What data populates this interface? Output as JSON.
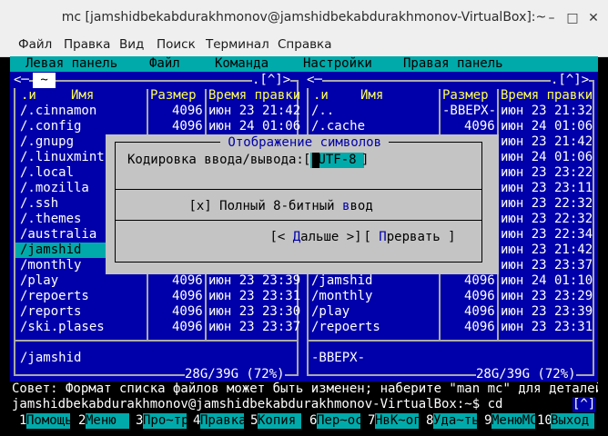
{
  "window": {
    "title": "mc [jamshidbekabdurakhmonov@jamshidbekabdurakhmonov-VirtualBox]:~",
    "minimize_glyph": "–",
    "maximize_glyph": "□",
    "close_glyph": "✕"
  },
  "menubar": {
    "items": [
      "Файл",
      "Правка",
      "Вид",
      "Поиск",
      "Терминал",
      "Справка"
    ]
  },
  "mc_menu": {
    "items": [
      "Левая панель",
      "Файл",
      "Команда",
      "Настройки",
      "Правая панель"
    ]
  },
  "left_panel": {
    "top_left": "<─",
    "tab": " ~ ",
    "top_right": ".[^]>",
    "col_n": ".и",
    "col_name": "Имя",
    "col_size": "Размер",
    "col_time": "Время правки",
    "rows": [
      {
        "name": "/.cinnamon",
        "size": "4096",
        "time": "июн 23 21:42"
      },
      {
        "name": "/.config",
        "size": "4096",
        "time": "июн 24 01:06"
      },
      {
        "name": "/.gnupg",
        "size": "",
        "time": ""
      },
      {
        "name": "/.linuxmint",
        "size": "",
        "time": ""
      },
      {
        "name": "/.local",
        "size": "",
        "time": ""
      },
      {
        "name": "/.mozilla",
        "size": "",
        "time": ""
      },
      {
        "name": "/.ssh",
        "size": "",
        "time": ""
      },
      {
        "name": "/.themes",
        "size": "",
        "time": ""
      },
      {
        "name": "/australia",
        "size": "",
        "time": ""
      },
      {
        "name": "/jamshid",
        "size": "",
        "time": ""
      },
      {
        "name": "/monthly",
        "size": "",
        "time": ""
      },
      {
        "name": "/play",
        "size": "4096",
        "time": "июн 23 23:39"
      },
      {
        "name": "/repoerts",
        "size": "4096",
        "time": "июн 23 23:31"
      },
      {
        "name": "/reports",
        "size": "4096",
        "time": "июн 23 23:30"
      },
      {
        "name": "/ski.plases",
        "size": "4096",
        "time": "июн 23 23:37"
      }
    ],
    "mini_status": "/jamshid",
    "disk": "28G/39G (72%)"
  },
  "right_panel": {
    "top_left": "<─",
    "top_right": ".[^]>",
    "col_n": ".и",
    "col_name": "Имя",
    "col_size": "Размер",
    "col_time": "Время правки",
    "rows": [
      {
        "name": "/..",
        "size": "-ВВЕРХ-",
        "time": "июн 23 21:32"
      },
      {
        "name": "/.cache",
        "size": "4096",
        "time": "июн 24 01:06"
      },
      {
        "name": "",
        "size": "",
        "time": "июн 23 21:42"
      },
      {
        "name": "",
        "size": "",
        "time": "июн 24 01:06"
      },
      {
        "name": "",
        "size": "",
        "time": "июн 23 23:22"
      },
      {
        "name": "",
        "size": "",
        "time": "июн 23 23:11"
      },
      {
        "name": "",
        "size": "",
        "time": "июн 23 22:32"
      },
      {
        "name": "",
        "size": "",
        "time": "июн 23 22:32"
      },
      {
        "name": "",
        "size": "",
        "time": "июн 23 22:34"
      },
      {
        "name": "",
        "size": "",
        "time": "июн 23 21:42"
      },
      {
        "name": "",
        "size": "",
        "time": "июн 23 23:37"
      },
      {
        "name": "/jamshid",
        "size": "4096",
        "time": "июн 24 01:10"
      },
      {
        "name": "/monthly",
        "size": "4096",
        "time": "июн 23 23:29"
      },
      {
        "name": "/play",
        "size": "4096",
        "time": "июн 23 23:39"
      },
      {
        "name": "/repoerts",
        "size": "4096",
        "time": "июн 23 23:31"
      }
    ],
    "mini_status": "-ВВЕРХ-",
    "disk": "28G/39G (72%)"
  },
  "dialog": {
    "title": " Отображение символов ",
    "encoding_label": "Кодировка ввода/вывода:",
    "encoding_bracket_open": "[",
    "encoding_value": " UTF-8 ",
    "encoding_bracket_close": "]",
    "checkbox_mark": "[x]",
    "checkbox_label_pre": "Полный 8-битный ",
    "checkbox_hotkey": "в",
    "checkbox_label_post": "вод",
    "next_open": "[< ",
    "next_hotkey": "Д",
    "next_rest": "альше >]",
    "cancel_open": "[ ",
    "cancel_hotkey": "П",
    "cancel_rest": "рервать ]"
  },
  "hint": "Совет: Формат списка файлов может быть изменен; наберите \"man mc\" для деталей.",
  "prompt": "jamshidbekabdurakhmonov@jamshidbekabdurakhmonov-VirtualBox:~$ cd",
  "prompt_right": "[^]",
  "fkeys": [
    {
      "num": "1",
      "label": "Помощь"
    },
    {
      "num": "2",
      "label": "Меню"
    },
    {
      "num": "3",
      "label": "Про~тр"
    },
    {
      "num": "4",
      "label": "Правка"
    },
    {
      "num": "5",
      "label": "Копия"
    },
    {
      "num": "6",
      "label": "Пер~ос"
    },
    {
      "num": "7",
      "label": "НвК~ог"
    },
    {
      "num": "8",
      "label": "Уда~ть"
    },
    {
      "num": "9",
      "label": "МенюМС"
    },
    {
      "num": "10",
      "label": "Выход"
    }
  ],
  "colors": {
    "panel_bg": "#0000aa",
    "cyan": "#00ffff",
    "yellow": "#ffff55",
    "dialog_bg": "#c4c4c4",
    "selection": "#00aaaa"
  }
}
